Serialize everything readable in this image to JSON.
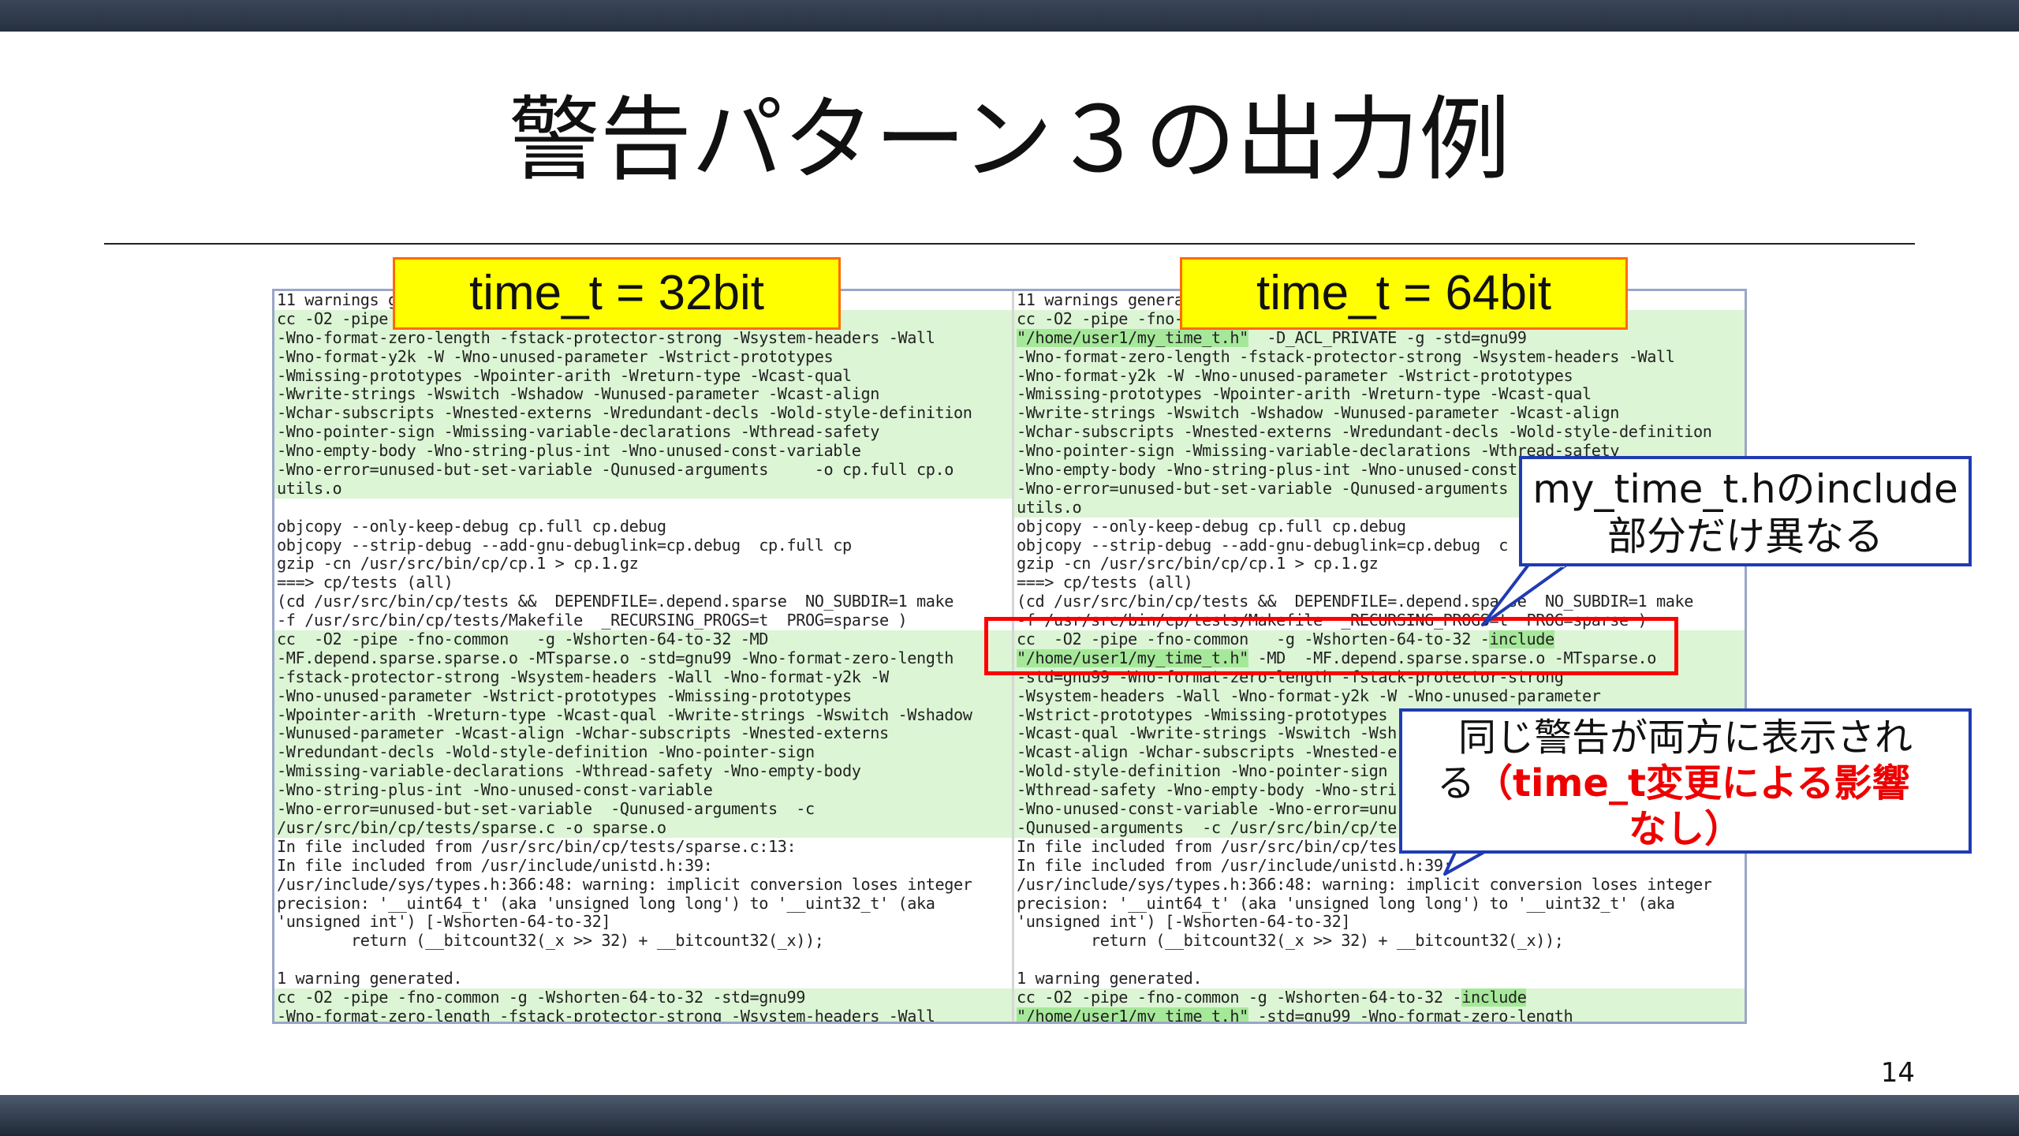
{
  "slide": {
    "title": "警告パターン３の出力例",
    "page_number": "14"
  },
  "labels": {
    "left": "time_t = 32bit",
    "right": "time_t = 64bit"
  },
  "callouts": {
    "include_note": {
      "line1": "my_time_t.hのinclude",
      "line2": "部分だけ異なる"
    },
    "same_warning": {
      "line1": "同じ警告が両方に表示され",
      "line2_plain": "る",
      "line2_red": "（time_t変更による影響",
      "line3_red": "なし）"
    }
  },
  "left_pane": [
    {
      "text": "11 warnings g",
      "bg": "w"
    },
    {
      "text": "cc -O2 -pipe                                   -std=gnu99",
      "bg": "g"
    },
    {
      "text": "-Wno-format-zero-length -fstack-protector-strong -Wsystem-headers -Wall",
      "bg": "g"
    },
    {
      "text": "-Wno-format-y2k -W -Wno-unused-parameter -Wstrict-prototypes",
      "bg": "g"
    },
    {
      "text": "-Wmissing-prototypes -Wpointer-arith -Wreturn-type -Wcast-qual",
      "bg": "g"
    },
    {
      "text": "-Wwrite-strings -Wswitch -Wshadow -Wunused-parameter -Wcast-align",
      "bg": "g"
    },
    {
      "text": "-Wchar-subscripts -Wnested-externs -Wredundant-decls -Wold-style-definition",
      "bg": "g"
    },
    {
      "text": "-Wno-pointer-sign -Wmissing-variable-declarations -Wthread-safety",
      "bg": "g"
    },
    {
      "text": "-Wno-empty-body -Wno-string-plus-int -Wno-unused-const-variable",
      "bg": "g"
    },
    {
      "text": "-Wno-error=unused-but-set-variable -Qunused-arguments     -o cp.full cp.o",
      "bg": "g"
    },
    {
      "text": "utils.o",
      "bg": "g"
    },
    {
      "text": "",
      "bg": "w"
    },
    {
      "text": "objcopy --only-keep-debug cp.full cp.debug",
      "bg": "w"
    },
    {
      "text": "objcopy --strip-debug --add-gnu-debuglink=cp.debug  cp.full cp",
      "bg": "w"
    },
    {
      "text": "gzip -cn /usr/src/bin/cp/cp.1 > cp.1.gz",
      "bg": "w"
    },
    {
      "text": "===> cp/tests (all)",
      "bg": "w"
    },
    {
      "text": "(cd /usr/src/bin/cp/tests &&  DEPENDFILE=.depend.sparse  NO_SUBDIR=1 make",
      "bg": "w"
    },
    {
      "text": "-f /usr/src/bin/cp/tests/Makefile  _RECURSING_PROGS=t  PROG=sparse )",
      "bg": "w"
    },
    {
      "text": "cc  -O2 -pipe -fno-common   -g -Wshorten-64-to-32 -MD",
      "bg": "g"
    },
    {
      "text": "-MF.depend.sparse.sparse.o -MTsparse.o -std=gnu99 -Wno-format-zero-length",
      "bg": "g"
    },
    {
      "text": "-fstack-protector-strong -Wsystem-headers -Wall -Wno-format-y2k -W",
      "bg": "g"
    },
    {
      "text": "-Wno-unused-parameter -Wstrict-prototypes -Wmissing-prototypes",
      "bg": "g"
    },
    {
      "text": "-Wpointer-arith -Wreturn-type -Wcast-qual -Wwrite-strings -Wswitch -Wshadow",
      "bg": "g"
    },
    {
      "text": "-Wunused-parameter -Wcast-align -Wchar-subscripts -Wnested-externs",
      "bg": "g"
    },
    {
      "text": "-Wredundant-decls -Wold-style-definition -Wno-pointer-sign",
      "bg": "g"
    },
    {
      "text": "-Wmissing-variable-declarations -Wthread-safety -Wno-empty-body",
      "bg": "g"
    },
    {
      "text": "-Wno-string-plus-int -Wno-unused-const-variable",
      "bg": "g"
    },
    {
      "text": "-Wno-error=unused-but-set-variable  -Qunused-arguments  -c",
      "bg": "g"
    },
    {
      "text": "/usr/src/bin/cp/tests/sparse.c -o sparse.o",
      "bg": "g"
    },
    {
      "text": "In file included from /usr/src/bin/cp/tests/sparse.c:13:",
      "bg": "w"
    },
    {
      "text": "In file included from /usr/include/unistd.h:39:",
      "bg": "w"
    },
    {
      "text": "/usr/include/sys/types.h:366:48: warning: implicit conversion loses integer",
      "bg": "w"
    },
    {
      "text": "precision: '__uint64_t' (aka 'unsigned long long') to '__uint32_t' (aka",
      "bg": "w"
    },
    {
      "text": "'unsigned int') [-Wshorten-64-to-32]",
      "bg": "w"
    },
    {
      "text": "        return (__bitcount32(_x >> 32) + __bitcount32(_x));",
      "bg": "w"
    },
    {
      "text": "",
      "bg": "w"
    },
    {
      "text": "1 warning generated.",
      "bg": "w"
    },
    {
      "text": "cc -O2 -pipe -fno-common -g -Wshorten-64-to-32 -std=gnu99",
      "bg": "g"
    },
    {
      "text": "-Wno-format-zero-length -fstack-protector-strong -Wsystem-headers -Wall",
      "bg": "g"
    }
  ],
  "right_pane": [
    {
      "text": "11 warnings genera",
      "bg": "w"
    },
    {
      "text": "cc -O2 -pipe -fno-",
      "bg": "g"
    },
    {
      "text": "\"/home/user1/my_time_t.h\"  -D_ACL_PRIVATE -g -std=gnu99",
      "bg": "g",
      "hl": "\"/home/user1/my_time_t.h\""
    },
    {
      "text": "-Wno-format-zero-length -fstack-protector-strong -Wsystem-headers -Wall",
      "bg": "g"
    },
    {
      "text": "-Wno-format-y2k -W -Wno-unused-parameter -Wstrict-prototypes",
      "bg": "g"
    },
    {
      "text": "-Wmissing-prototypes -Wpointer-arith -Wreturn-type -Wcast-qual",
      "bg": "g"
    },
    {
      "text": "-Wwrite-strings -Wswitch -Wshadow -Wunused-parameter -Wcast-align",
      "bg": "g"
    },
    {
      "text": "-Wchar-subscripts -Wnested-externs -Wredundant-decls -Wold-style-definition",
      "bg": "g"
    },
    {
      "text": "-Wno-pointer-sign -Wmissing-variable-declarations -Wthread-safety",
      "bg": "g"
    },
    {
      "text": "-Wno-empty-body -Wno-string-plus-int -Wno-unused-const",
      "bg": "g"
    },
    {
      "text": "-Wno-error=unused-but-set-variable -Qunused-arguments",
      "bg": "g"
    },
    {
      "text": "utils.o",
      "bg": "g"
    },
    {
      "text": "objcopy --only-keep-debug cp.full cp.debug",
      "bg": "w"
    },
    {
      "text": "objcopy --strip-debug --add-gnu-debuglink=cp.debug  c",
      "bg": "w"
    },
    {
      "text": "gzip -cn /usr/src/bin/cp/cp.1 > cp.1.gz",
      "bg": "w"
    },
    {
      "text": "===> cp/tests (all)",
      "bg": "w"
    },
    {
      "text": "(cd /usr/src/bin/cp/tests &&  DEPENDFILE=.depend.sparse  NO_SUBDIR=1 make",
      "bg": "w"
    },
    {
      "text": "-f /usr/src/bin/cp/tests/Makefile  _RECURSING_PROGS=t  PROG=sparse )",
      "bg": "w"
    },
    {
      "text": "cc  -O2 -pipe -fno-common   -g -Wshorten-64-to-32 -include",
      "bg": "g",
      "hl": "include"
    },
    {
      "text": "\"/home/user1/my_time_t.h\" -MD  -MF.depend.sparse.sparse.o -MTsparse.o",
      "bg": "g",
      "hl": "\"/home/user1/my_time_t.h\""
    },
    {
      "text": "-std=gnu99 -Wno-format-zero-length -fstack-protector-strong",
      "bg": "g"
    },
    {
      "text": "-Wsystem-headers -Wall -Wno-format-y2k -W -Wno-unused-parameter",
      "bg": "g"
    },
    {
      "text": "-Wstrict-prototypes -Wmissing-prototypes",
      "bg": "g"
    },
    {
      "text": "-Wcast-qual -Wwrite-strings -Wswitch -Wsh",
      "bg": "g"
    },
    {
      "text": "-Wcast-align -Wchar-subscripts -Wnested-e",
      "bg": "g"
    },
    {
      "text": "-Wold-style-definition -Wno-pointer-sign",
      "bg": "g"
    },
    {
      "text": "-Wthread-safety -Wno-empty-body -Wno-stri",
      "bg": "g"
    },
    {
      "text": "-Wno-unused-const-variable -Wno-error=unu",
      "bg": "g"
    },
    {
      "text": "-Qunused-arguments  -c /usr/src/bin/cp/te",
      "bg": "g"
    },
    {
      "text": "In file included from /usr/src/bin/cp/tes",
      "bg": "w"
    },
    {
      "text": "In file included from /usr/include/unistd.h:39:",
      "bg": "w"
    },
    {
      "text": "/usr/include/sys/types.h:366:48: warning: implicit conversion loses integer",
      "bg": "w"
    },
    {
      "text": "precision: '__uint64_t' (aka 'unsigned long long') to '__uint32_t' (aka",
      "bg": "w"
    },
    {
      "text": "'unsigned int') [-Wshorten-64-to-32]",
      "bg": "w"
    },
    {
      "text": "        return (__bitcount32(_x >> 32) + __bitcount32(_x));",
      "bg": "w"
    },
    {
      "text": "",
      "bg": "w"
    },
    {
      "text": "1 warning generated.",
      "bg": "w"
    },
    {
      "text": "cc -O2 -pipe -fno-common -g -Wshorten-64-to-32 -include",
      "bg": "g",
      "hl": "include"
    },
    {
      "text": "\"/home/user1/my_time_t.h\" -std=gnu99 -Wno-format-zero-length",
      "bg": "g",
      "hl": "\"/home/user1/my_time_t.h\""
    }
  ]
}
